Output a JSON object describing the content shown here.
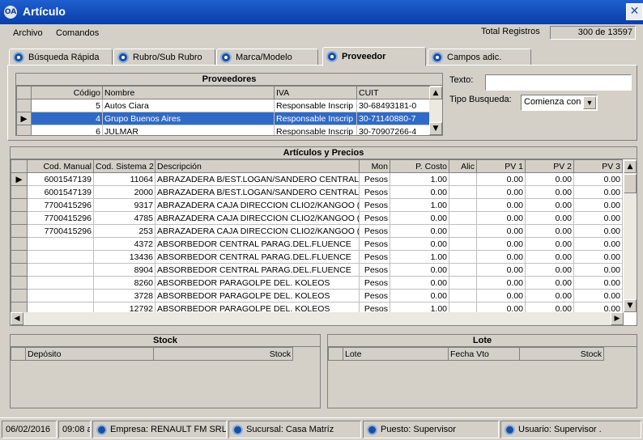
{
  "window": {
    "title": "Artículo",
    "icon": "app-icon",
    "close": "✕"
  },
  "menu": {
    "archivo": "Archivo",
    "comandos": "Comandos"
  },
  "total": {
    "label": "Total Registros",
    "value": "300 de 13597"
  },
  "tabs": [
    {
      "label": "Búsqueda Rápida",
      "icon": "search-icon"
    },
    {
      "label": "Rubro/Sub Rubro",
      "icon": "search-icon"
    },
    {
      "label": "Marca/Modelo",
      "icon": "search-icon"
    },
    {
      "label": "Proveedor",
      "icon": "search-icon",
      "active": true
    },
    {
      "label": "Campos adic.",
      "icon": "search-icon"
    }
  ],
  "proveedores": {
    "title": "Proveedores",
    "columns": [
      "Código",
      "Nombre",
      "IVA",
      "CUIT"
    ],
    "rows": [
      [
        "5",
        "Autos Ciara",
        "Responsable Inscrip",
        "30-68493181-0"
      ],
      [
        "4",
        "Grupo Buenos Aires",
        "Responsable Inscrip",
        "30-71140880-7"
      ],
      [
        "6",
        "JULMAR",
        "Responsable Inscrip",
        "30-70907266-4"
      ]
    ]
  },
  "search": {
    "texto_label": "Texto:",
    "texto_value": "",
    "tipo_label": "Tipo Busqueda:",
    "tipo_value": "Comienza con"
  },
  "articulos": {
    "title": "Artículos y Precios",
    "columns": [
      "Cod. Manual",
      "Cod. Sistema 2",
      "Descripción",
      "Mon",
      "P. Costo",
      "Alic",
      "PV 1",
      "PV 2",
      "PV 3"
    ],
    "rows": [
      [
        "6001547139",
        "11064",
        "ABRAZADERA B/EST.LOGAN/SANDERO CENTRAL",
        "Pesos",
        "1.00",
        "",
        "0.00",
        "0.00",
        "0.00"
      ],
      [
        "6001547139",
        "2000",
        "ABRAZADERA B/EST.LOGAN/SANDERO CENTRAL",
        "Pesos",
        "0.00",
        "",
        "0.00",
        "0.00",
        "0.00"
      ],
      [
        "7700415296",
        "9317",
        "ABRAZADERA CAJA DIRECCION CLIO2/KANGOO (",
        "Pesos",
        "1.00",
        "",
        "0.00",
        "0.00",
        "0.00"
      ],
      [
        "7700415296",
        "4785",
        "ABRAZADERA CAJA DIRECCION CLIO2/KANGOO (",
        "Pesos",
        "0.00",
        "",
        "0.00",
        "0.00",
        "0.00"
      ],
      [
        "7700415296",
        "253",
        "ABRAZADERA CAJA DIRECCION CLIO2/KANGOO (",
        "Pesos",
        "0.00",
        "",
        "0.00",
        "0.00",
        "0.00"
      ],
      [
        "",
        "4372",
        "ABSORBEDOR CENTRAL PARAG.DEL.FLUENCE",
        "Pesos",
        "0.00",
        "",
        "0.00",
        "0.00",
        "0.00"
      ],
      [
        "",
        "13436",
        "ABSORBEDOR CENTRAL PARAG.DEL.FLUENCE",
        "Pesos",
        "1.00",
        "",
        "0.00",
        "0.00",
        "0.00"
      ],
      [
        "",
        "8904",
        "ABSORBEDOR CENTRAL PARAG.DEL.FLUENCE",
        "Pesos",
        "0.00",
        "",
        "0.00",
        "0.00",
        "0.00"
      ],
      [
        "",
        "8260",
        "ABSORBEDOR PARAGOLPE DEL. KOLEOS",
        "Pesos",
        "0.00",
        "",
        "0.00",
        "0.00",
        "0.00"
      ],
      [
        "",
        "3728",
        "ABSORBEDOR PARAGOLPE DEL. KOLEOS",
        "Pesos",
        "0.00",
        "",
        "0.00",
        "0.00",
        "0.00"
      ],
      [
        "",
        "12792",
        "ABSORBEDOR PARAGOLPE DEL. KOLEOS",
        "Pesos",
        "1.00",
        "",
        "0.00",
        "0.00",
        "0.00"
      ]
    ]
  },
  "stock": {
    "title": "Stock",
    "columns": [
      "Depósito",
      "Stock"
    ]
  },
  "lote": {
    "title": "Lote",
    "columns": [
      "Lote",
      "Fecha Vto",
      "Stock"
    ]
  },
  "status": {
    "date": "06/02/2016",
    "time": "09:08 a",
    "empresa": "Empresa: RENAULT FM SRL",
    "sucursal": "Sucursal: Casa Matríz",
    "puesto": "Puesto: Supervisor",
    "usuario": "Usuario: Supervisor ."
  },
  "colors": {
    "titlebar": "#0a3ea8",
    "selection": "#316ac5",
    "face": "#d4d0c8"
  }
}
